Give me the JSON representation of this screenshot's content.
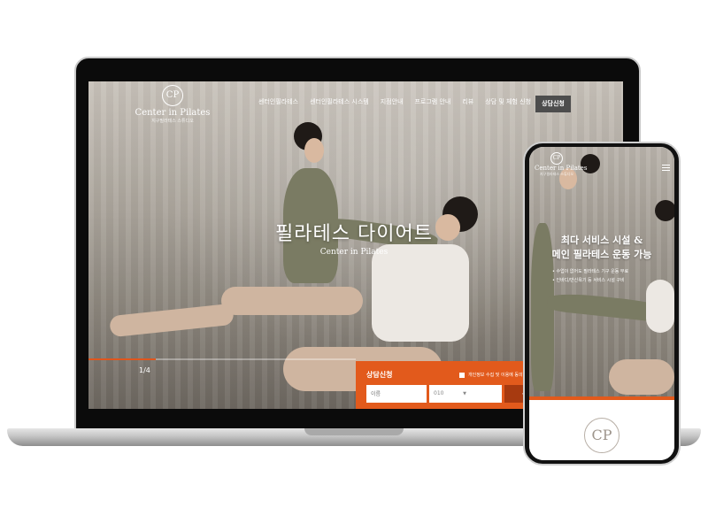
{
  "brand": {
    "logo_mark": "CP",
    "name": "Center in Pilates",
    "subtitle": "지구필라테스 스튜디오"
  },
  "laptop": {
    "nav": [
      "센터인필라테스",
      "센터인필라테스 시스템",
      "지점안내",
      "프로그램 안내",
      "리뷰",
      "상담 및 체험 신청"
    ],
    "cta_label": "상담신청",
    "hero_title": "필라테스 다이어트",
    "hero_subtitle": "Center in Pilates",
    "slide_counter": "1/4",
    "slide_progress": 0.25,
    "form": {
      "title": "상담신청",
      "consent_text": "개인정보 수집 및 이용에 동의합",
      "name_placeholder": "이름",
      "phone_prefix": "010",
      "select_caret": "▼",
      "submit_label": "신"
    }
  },
  "phone": {
    "hero_title_line1": "최다 서비스 시설 &",
    "hero_title_line2": "메인 필라테스 운동 가능",
    "bullets": [
      "수업이 없어도 필라테스 기구 운동 무료",
      "인바디/반신욕기 등 서비스 시설 구비"
    ],
    "menu_icon": "hamburger-menu-icon",
    "bottom_logo_mark": "CP"
  },
  "colors": {
    "accent": "#e25a1c",
    "cta_dark": "#4d4d4d"
  }
}
